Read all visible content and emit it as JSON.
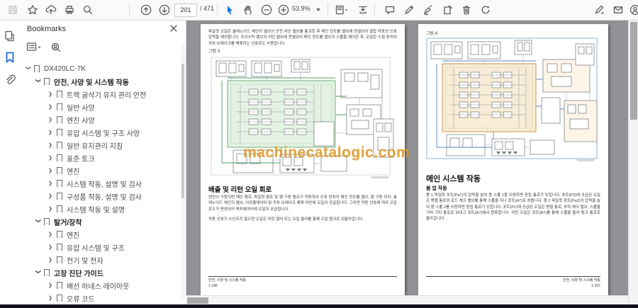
{
  "toolbar": {
    "page_current": "201",
    "page_total": "/ 471",
    "zoom_level": "53.9%",
    "icons": [
      "save",
      "star",
      "cloud-upload",
      "print",
      "search",
      "previous-page",
      "next-page",
      "select-tool",
      "hand-tool",
      "zoom-out",
      "zoom-in",
      "fit-page",
      "fit-width",
      "comment",
      "pencil",
      "sign",
      "rotate-pages",
      "trash",
      "refresh",
      "fill-and-sign",
      "email",
      "account"
    ]
  },
  "left_rail": {
    "icons": [
      "page-thumbnails",
      "bookmarks",
      "attachments"
    ],
    "active": "bookmarks"
  },
  "bookmarks": {
    "title": "Bookmarks",
    "items": [
      {
        "label": "DX420LC-7K",
        "level": 0,
        "expanded": true,
        "bold": false
      },
      {
        "label": "안전, 사양 및 시스템 작동",
        "level": 1,
        "expanded": true,
        "bold": true
      },
      {
        "label": "트랙 굴삭기 유지 관리 안전",
        "level": 2,
        "expanded": false,
        "bold": false
      },
      {
        "label": "일반 사양",
        "level": 2,
        "expanded": false,
        "bold": false
      },
      {
        "label": "엔진 사양",
        "level": 2,
        "expanded": false,
        "bold": false
      },
      {
        "label": "유압 시스템 및 구조 사양",
        "level": 2,
        "expanded": false,
        "bold": false
      },
      {
        "label": "일반 유지관리 지침",
        "level": 2,
        "expanded": false,
        "bold": false
      },
      {
        "label": "표준 토크",
        "level": 2,
        "expanded": false,
        "bold": false
      },
      {
        "label": "엔진",
        "level": 2,
        "expanded": false,
        "bold": false
      },
      {
        "label": "시스템 작동, 설명 및 검사",
        "level": 2,
        "expanded": false,
        "bold": false
      },
      {
        "label": "구성품 작동, 설명 및 검사",
        "level": 2,
        "expanded": false,
        "bold": false
      },
      {
        "label": "시스템 작동 및 설명",
        "level": 2,
        "expanded": false,
        "bold": false
      },
      {
        "label": "탈거/장착",
        "level": 1,
        "expanded": true,
        "bold": true
      },
      {
        "label": "엔진",
        "level": 2,
        "expanded": false,
        "bold": false
      },
      {
        "label": "유압 시스템 및 구조",
        "level": 2,
        "expanded": false,
        "bold": false
      },
      {
        "label": "전기 및 전자",
        "level": 2,
        "expanded": false,
        "bold": false
      },
      {
        "label": "고장 진단 가이드",
        "level": 1,
        "expanded": true,
        "bold": true
      },
      {
        "label": "배선 하네스 레이아웃",
        "level": 2,
        "expanded": false,
        "bold": false
      },
      {
        "label": "오류 코드",
        "level": 2,
        "expanded": false,
        "bold": false
      }
    ]
  },
  "pages": {
    "left": {
      "intro_text": "파일럿 오일은 솔레노이드 체인지 밸브의 안전 차단 밸브를 통과한 후 메인 컨트롤 밸브에 연결되어 결합 작동의 신호 압력을 제어합니다. 조이스틱 밸브의 리턴 밸브에 연결되어 메인 컨트롤 밸브의 스풀을 제어한 후, 오일은 스윙 장치의 주차 브레이크를 해제하는 신호로도 사용됩니다.",
      "figure_label": "그림 3",
      "heading": "배출 및 리턴 오일 회로",
      "body1": "엔진이 구동되면 메인 펌프, 파일럿 펌프 및 팬 구동 펌프가 작동하여 신호 장치의 메인 컨트롤 밸브, 팬 구동 모터, 솔레노이드 체인지 밸브, 어큐뮬레이터 및 주차 브레이크 해제 라인에 오일이 공급됩니다. 그러면 작동 신호에 따라 오일 온도가 변경되어 액추에이터에 오일이 공급됩니다.",
      "body2": "작동 신호가 수신되지 않으면 오일은 리턴 필터 또는 오일 쿨러를 통해 오일 탱크로 되돌아갑니다.",
      "diagram_code": "DS2000006",
      "footer_title": "안전, 사양 및 시스템 작동",
      "footer_page": "1-196"
    },
    "right": {
      "figure_label": "그림 4",
      "heading": "메인 시스템 작동",
      "subheading": "붐 업 작동",
      "body1": "붐 1 파일럿 포트(Pa7)의 압력을 높여 붐 스풀 1을 이동하면 중립 통로가 닫힙니다. 포트(P2)에 공급된 오일은 병렬 통로와 로드 체크 밸브를 통해 스풀을 지나 포트(A7)로 흐릅니다. 붐 2 파일럿 포트(Pa2)의 압력을 높여 붐 스풀 2를 이동하면 중립 통로가 닫힙니다. 포트(P1)에 공급된 오일은 병렬 통로, 부하 체크 밸브, 스풀을 거쳐 기타 통로로 보내고 포트(A7)에서 합류합니다. 리턴 오일은 포트(B7)를 통해 스풀을 돌아 탱크 통로로 돌아갑니다.",
      "diagram_code": "DS2000010",
      "footer_title": "안전, 사양 및 시스템 작동",
      "footer_page": "1-197"
    }
  },
  "watermark": {
    "text": "machinecatalogic.com",
    "color": "#e09a25"
  }
}
